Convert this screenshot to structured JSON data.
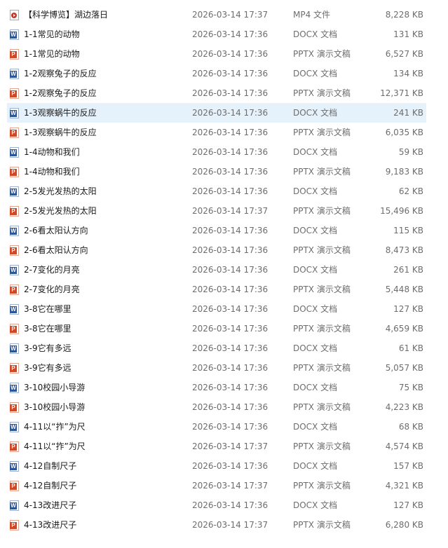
{
  "files": [
    {
      "name": "【科学博览】湖边落日",
      "modified": "2026-03-14 17:37",
      "type": "MP4 文件",
      "size": "8,228 KB",
      "icon": "video-file-icon"
    },
    {
      "name": "1-1常见的动物",
      "modified": "2026-03-14 17:36",
      "type": "DOCX 文档",
      "size": "131 KB",
      "icon": "word-file-icon"
    },
    {
      "name": "1-1常见的动物",
      "modified": "2026-03-14 17:36",
      "type": "PPTX 演示文稿",
      "size": "6,527 KB",
      "icon": "powerpoint-file-icon"
    },
    {
      "name": "1-2观察兔子的反应",
      "modified": "2026-03-14 17:36",
      "type": "DOCX 文档",
      "size": "134 KB",
      "icon": "word-file-icon"
    },
    {
      "name": "1-2观察兔子的反应",
      "modified": "2026-03-14 17:36",
      "type": "PPTX 演示文稿",
      "size": "12,371 KB",
      "icon": "powerpoint-file-icon"
    },
    {
      "name": "1-3观察蜗牛的反应",
      "modified": "2026-03-14 17:36",
      "type": "DOCX 文档",
      "size": "241 KB",
      "icon": "word-file-icon",
      "selected": true
    },
    {
      "name": "1-3观察蜗牛的反应",
      "modified": "2026-03-14 17:36",
      "type": "PPTX 演示文稿",
      "size": "6,035 KB",
      "icon": "powerpoint-file-icon"
    },
    {
      "name": "1-4动物和我们",
      "modified": "2026-03-14 17:36",
      "type": "DOCX 文档",
      "size": "59 KB",
      "icon": "word-file-icon"
    },
    {
      "name": "1-4动物和我们",
      "modified": "2026-03-14 17:36",
      "type": "PPTX 演示文稿",
      "size": "9,183 KB",
      "icon": "powerpoint-file-icon"
    },
    {
      "name": "2-5发光发热的太阳",
      "modified": "2026-03-14 17:36",
      "type": "DOCX 文档",
      "size": "62 KB",
      "icon": "word-file-icon"
    },
    {
      "name": "2-5发光发热的太阳",
      "modified": "2026-03-14 17:37",
      "type": "PPTX 演示文稿",
      "size": "15,496 KB",
      "icon": "powerpoint-file-icon"
    },
    {
      "name": "2-6看太阳认方向",
      "modified": "2026-03-14 17:36",
      "type": "DOCX 文档",
      "size": "115 KB",
      "icon": "word-file-icon"
    },
    {
      "name": "2-6看太阳认方向",
      "modified": "2026-03-14 17:36",
      "type": "PPTX 演示文稿",
      "size": "8,473 KB",
      "icon": "powerpoint-file-icon"
    },
    {
      "name": "2-7变化的月亮",
      "modified": "2026-03-14 17:36",
      "type": "DOCX 文档",
      "size": "261 KB",
      "icon": "word-file-icon"
    },
    {
      "name": "2-7变化的月亮",
      "modified": "2026-03-14 17:36",
      "type": "PPTX 演示文稿",
      "size": "5,448 KB",
      "icon": "powerpoint-file-icon"
    },
    {
      "name": "3-8它在哪里",
      "modified": "2026-03-14 17:36",
      "type": "DOCX 文档",
      "size": "127 KB",
      "icon": "word-file-icon"
    },
    {
      "name": "3-8它在哪里",
      "modified": "2026-03-14 17:36",
      "type": "PPTX 演示文稿",
      "size": "4,659 KB",
      "icon": "powerpoint-file-icon"
    },
    {
      "name": "3-9它有多远",
      "modified": "2026-03-14 17:36",
      "type": "DOCX 文档",
      "size": "61 KB",
      "icon": "word-file-icon"
    },
    {
      "name": "3-9它有多远",
      "modified": "2026-03-14 17:36",
      "type": "PPTX 演示文稿",
      "size": "5,057 KB",
      "icon": "powerpoint-file-icon"
    },
    {
      "name": "3-10校园小导游",
      "modified": "2026-03-14 17:36",
      "type": "DOCX 文档",
      "size": "75 KB",
      "icon": "word-file-icon"
    },
    {
      "name": "3-10校园小导游",
      "modified": "2026-03-14 17:36",
      "type": "PPTX 演示文稿",
      "size": "4,223 KB",
      "icon": "powerpoint-file-icon"
    },
    {
      "name": "4-11以“拃”为尺",
      "modified": "2026-03-14 17:36",
      "type": "DOCX 文档",
      "size": "68 KB",
      "icon": "word-file-icon"
    },
    {
      "name": "4-11以“拃”为尺",
      "modified": "2026-03-14 17:37",
      "type": "PPTX 演示文稿",
      "size": "4,574 KB",
      "icon": "powerpoint-file-icon"
    },
    {
      "name": "4-12自制尺子",
      "modified": "2026-03-14 17:36",
      "type": "DOCX 文档",
      "size": "157 KB",
      "icon": "word-file-icon"
    },
    {
      "name": "4-12自制尺子",
      "modified": "2026-03-14 17:37",
      "type": "PPTX 演示文稿",
      "size": "4,321 KB",
      "icon": "powerpoint-file-icon"
    },
    {
      "name": "4-13改进尺子",
      "modified": "2026-03-14 17:36",
      "type": "DOCX 文档",
      "size": "127 KB",
      "icon": "word-file-icon"
    },
    {
      "name": "4-13改进尺子",
      "modified": "2026-03-14 17:37",
      "type": "PPTX 演示文稿",
      "size": "6,280 KB",
      "icon": "powerpoint-file-icon"
    }
  ],
  "colors": {
    "selected_row": "#e5f1fb",
    "word_icon": "#2b5797",
    "powerpoint_icon": "#d24726",
    "video_icon": "#c0392b",
    "secondary_text": "#6d6d6d"
  }
}
